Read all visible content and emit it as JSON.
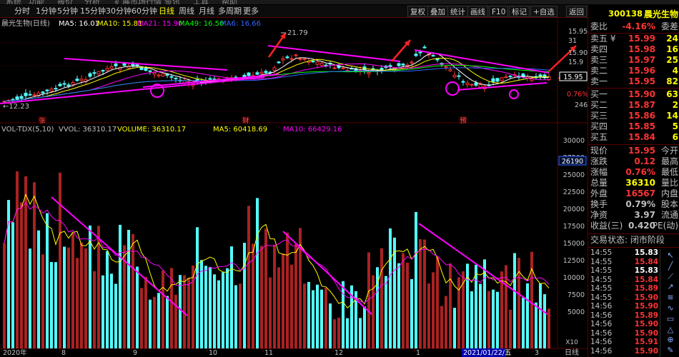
{
  "menu": [
    "系统",
    "功能",
    "报价",
    "分析",
    "扩展市场行情",
    "资讯",
    "工具",
    "帮助"
  ],
  "tabs": [
    "分时",
    "1分钟",
    "5分钟",
    "15分钟",
    "30分钟",
    "60分钟",
    "日线",
    "周线",
    "月线",
    "多周期",
    "更多"
  ],
  "active_tab": "日线",
  "toolbar_buttons": [
    "复权",
    "叠加",
    "统计",
    "画线",
    "F10",
    "标记",
    "+自选",
    "返回"
  ],
  "stock": {
    "code": "300138",
    "name": "晨光生物",
    "period": "晨光生物(日线)"
  },
  "ma_legend": [
    {
      "label": "MA5: 16.01",
      "color": "#ffffff"
    },
    {
      "label": "MA10: 15.81",
      "color": "#ffff00"
    },
    {
      "label": "MA21: 15.90",
      "color": "#ff00ff"
    },
    {
      "label": "MA49: 16.50",
      "color": "#00ff00"
    },
    {
      "label": "MA6: 16.66",
      "color": "#3366ff"
    }
  ],
  "price_annotations": {
    "high": "21.79",
    "low": "12.23",
    "current_up": "▲0.12",
    "pct": "0.76%",
    "count": "246"
  },
  "price_axis": [
    "15.95",
    "31",
    "15.90",
    "15.9",
    "15.95"
  ],
  "event_markers": [
    "张",
    "财",
    "预"
  ],
  "vol_legend": [
    {
      "label": "VOL-TDX(5,10)",
      "color": "#c0c0c0"
    },
    {
      "label": "VVOL: 36310.17",
      "color": "#c0c0c0"
    },
    {
      "label": "VOLUME: 36310.17",
      "color": "#ffff00"
    },
    {
      "label": "MA5: 60418.69",
      "color": "#ffff00"
    },
    {
      "label": "MA10: 66429.16",
      "color": "#ff00ff"
    }
  ],
  "vol_axis": [
    "30000",
    "27500",
    "25000",
    "22500",
    "20000",
    "17500",
    "15000",
    "12500",
    "10000",
    "7500",
    "5000"
  ],
  "vol_marker": "26190",
  "vol_unit": "X10",
  "date_labels": [
    "2020年",
    "8",
    "9",
    "10",
    "11",
    "12",
    "1",
    "2021/01/22/五",
    "3"
  ],
  "date_axis_label": "日线",
  "quote": {
    "ratio_label": "委比",
    "ratio_value": "-4.16%",
    "diff_label": "委差",
    "asks": [
      {
        "label": "卖五 ¥",
        "price": "15.99",
        "vol": "24"
      },
      {
        "label": "卖四",
        "price": "15.98",
        "vol": "16"
      },
      {
        "label": "卖三",
        "price": "15.97",
        "vol": "25"
      },
      {
        "label": "卖二",
        "price": "15.96",
        "vol": "4"
      },
      {
        "label": "卖一",
        "price": "15.95",
        "vol": "82"
      }
    ],
    "bids": [
      {
        "label": "买一",
        "price": "15.90",
        "vol": "63"
      },
      {
        "label": "买二",
        "price": "15.87",
        "vol": "2"
      },
      {
        "label": "买三",
        "price": "15.86",
        "vol": "14"
      },
      {
        "label": "买四",
        "price": "15.85",
        "vol": "5"
      },
      {
        "label": "买五",
        "price": "15.84",
        "vol": "6"
      }
    ],
    "stats": [
      {
        "label": "现价",
        "value": "15.95",
        "label2": "今开",
        "color": "#ff3333"
      },
      {
        "label": "涨跌",
        "value": "0.12",
        "label2": "最高",
        "color": "#ff3333"
      },
      {
        "label": "涨幅",
        "value": "0.76%",
        "label2": "最低",
        "color": "#ff3333"
      },
      {
        "label": "总量",
        "value": "36310",
        "label2": "量比",
        "color": "#ffff00"
      },
      {
        "label": "外盘",
        "value": "16567",
        "label2": "内盘",
        "color": "#ff3333"
      },
      {
        "label": "换手",
        "value": "0.79%",
        "label2": "股本",
        "color": "#c0c0c0"
      },
      {
        "label": "净资",
        "value": "3.97",
        "label2": "流通",
        "color": "#c0c0c0"
      },
      {
        "label": "收益(三)",
        "value": "0.420",
        "label2": "PE(动)",
        "color": "#c0c0c0"
      }
    ],
    "trade_status": "交易状态: 闭市阶段",
    "ticks": [
      {
        "time": "14:55",
        "price": "15.83",
        "color": "#ffffff"
      },
      {
        "time": "14:55",
        "price": "15.84",
        "color": "#ff3333"
      },
      {
        "time": "14:55",
        "price": "15.83",
        "color": "#ffffff"
      },
      {
        "time": "14:55",
        "price": "15.84",
        "color": "#ff3333"
      },
      {
        "time": "14:55",
        "price": "15.89",
        "color": "#ff3333"
      },
      {
        "time": "14:55",
        "price": "15.90",
        "color": "#ff3333"
      },
      {
        "time": "14:56",
        "price": "15.90",
        "color": "#ff3333"
      },
      {
        "time": "14:56",
        "price": "15.89",
        "color": "#ff3333"
      },
      {
        "time": "14:56",
        "price": "15.90",
        "color": "#ff3333"
      },
      {
        "time": "14:56",
        "price": "15.90",
        "color": "#ff3333"
      },
      {
        "time": "14:56",
        "price": "15.91",
        "color": "#ff3333"
      },
      {
        "time": "14:56",
        "price": "15.90",
        "color": "#ff3333"
      }
    ]
  },
  "colors": {
    "up": "#ff3333",
    "down": "#54ffff",
    "trend": "#ff00ff",
    "circle": "#ff00ff",
    "arrow": "#ff2222",
    "grid": "#5a0000"
  }
}
